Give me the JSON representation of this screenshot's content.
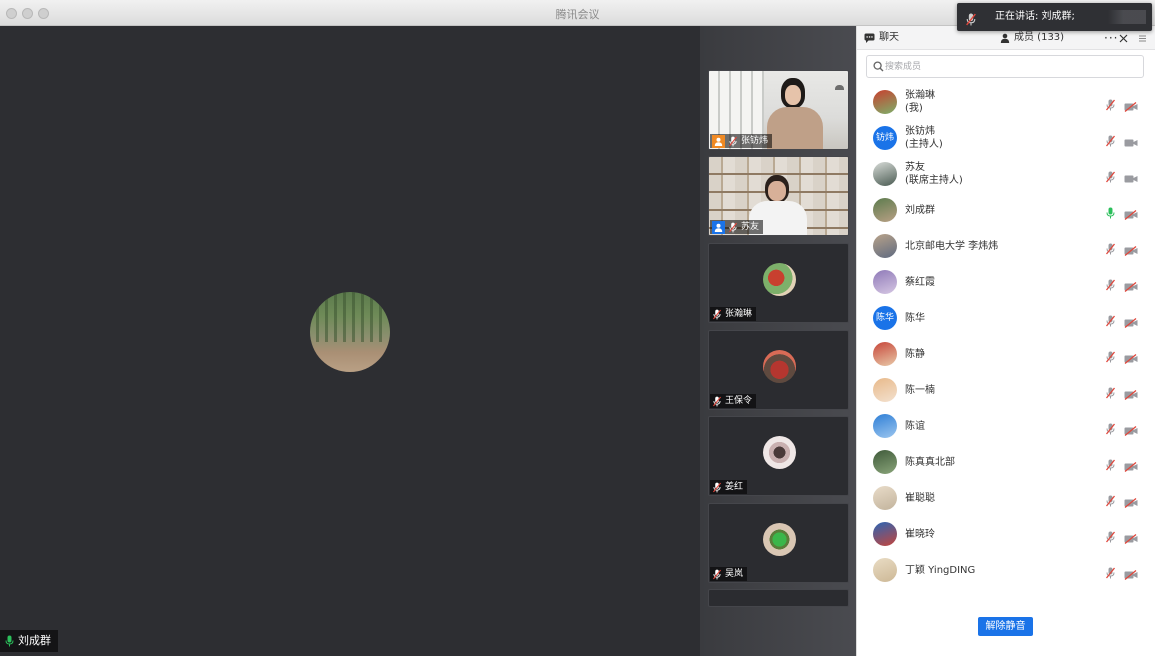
{
  "window": {
    "title": "腾讯会议"
  },
  "main_video": {
    "speaker_name": "刘成群",
    "mic_color": "#2bbf5b"
  },
  "talking_banner": {
    "text": "正在讲话: 刘成群;"
  },
  "filmstrip": [
    {
      "name": "张钫炜",
      "role": "host",
      "role_color": "#f08a24",
      "kind": "video-woman"
    },
    {
      "name": "苏友",
      "role": "cohost",
      "role_color": "#1a73e8",
      "kind": "video-man"
    },
    {
      "name": "张瀚琳",
      "kind": "avatar",
      "avatar_colors": [
        "#c8402f",
        "#7db06a",
        "#e2d2b6"
      ]
    },
    {
      "name": "王保令",
      "kind": "avatar",
      "avatar_colors": [
        "#b5362f",
        "#5f4a3f",
        "#d96b56"
      ]
    },
    {
      "name": "姜红",
      "kind": "avatar",
      "avatar_colors": [
        "#efe7e6",
        "#4a3a39",
        "#c9b0b0"
      ]
    },
    {
      "name": "吴岚",
      "kind": "avatar",
      "avatar_colors": [
        "#3bb64a",
        "#d9c6b3",
        "#5a7d3a"
      ]
    }
  ],
  "panel": {
    "tab_chat": "聊天",
    "tab_members": "成员 (133)",
    "more_icon": "more-icon",
    "close_icon": "close-icon",
    "menu_icon": "menu-icon",
    "search_placeholder": "搜索成员",
    "unmute_button": "解除静音",
    "accent_color": "#1a73e8"
  },
  "members": [
    {
      "name": "张瀚琳",
      "sub": "(我)",
      "avatar": "photo",
      "colors": [
        "#c8402f",
        "#7db06a"
      ],
      "mic": "off",
      "cam": "off"
    },
    {
      "name": "张钫炜",
      "sub": "(主持人)",
      "avatar": "text",
      "avatar_text": "钫炜",
      "colors": [
        "#1a73e8",
        "#1a73e8"
      ],
      "mic": "off",
      "cam": "on"
    },
    {
      "name": "苏友",
      "sub": "(联席主持人)",
      "avatar": "photo",
      "colors": [
        "#d8dcd8",
        "#4a5b52"
      ],
      "mic": "off",
      "cam": "on"
    },
    {
      "name": "刘成群",
      "sub": "",
      "avatar": "photo",
      "colors": [
        "#5c7b4d",
        "#b9a085"
      ],
      "mic": "on",
      "cam": "off"
    },
    {
      "name": "北京邮电大学 李炜炜",
      "sub": "",
      "avatar": "photo",
      "colors": [
        "#b9a38a",
        "#5f6a80"
      ],
      "mic": "off",
      "cam": "off"
    },
    {
      "name": "蔡红霞",
      "sub": "",
      "avatar": "photo",
      "colors": [
        "#8f7ab8",
        "#d6c7e3"
      ],
      "mic": "off",
      "cam": "off"
    },
    {
      "name": "陈华",
      "sub": "",
      "avatar": "text",
      "avatar_text": "陈华",
      "colors": [
        "#1a73e8",
        "#1a73e8"
      ],
      "mic": "off",
      "cam": "off"
    },
    {
      "name": "陈静",
      "sub": "",
      "avatar": "photo",
      "colors": [
        "#c7463a",
        "#e8c9a8"
      ],
      "mic": "off",
      "cam": "off"
    },
    {
      "name": "陈一楠",
      "sub": "",
      "avatar": "photo",
      "colors": [
        "#e8b98a",
        "#f3e1cf"
      ],
      "mic": "off",
      "cam": "off"
    },
    {
      "name": "陈谊",
      "sub": "",
      "avatar": "photo",
      "colors": [
        "#2f7fd6",
        "#9cc6ef"
      ],
      "mic": "off",
      "cam": "off"
    },
    {
      "name": "陈真真北部",
      "sub": "",
      "avatar": "photo",
      "colors": [
        "#3f5a3a",
        "#8aa57a"
      ],
      "mic": "off",
      "cam": "off"
    },
    {
      "name": "崔聪聪",
      "sub": "",
      "avatar": "photo",
      "colors": [
        "#e9dcc9",
        "#c2b39c"
      ],
      "mic": "off",
      "cam": "off"
    },
    {
      "name": "崔晓玲",
      "sub": "",
      "avatar": "photo",
      "colors": [
        "#2a65b5",
        "#c4453c"
      ],
      "mic": "off",
      "cam": "off"
    },
    {
      "name": "丁颖 YingDING",
      "sub": "",
      "avatar": "photo",
      "colors": [
        "#e9dcc4",
        "#cdb896"
      ],
      "mic": "off",
      "cam": "off"
    }
  ]
}
